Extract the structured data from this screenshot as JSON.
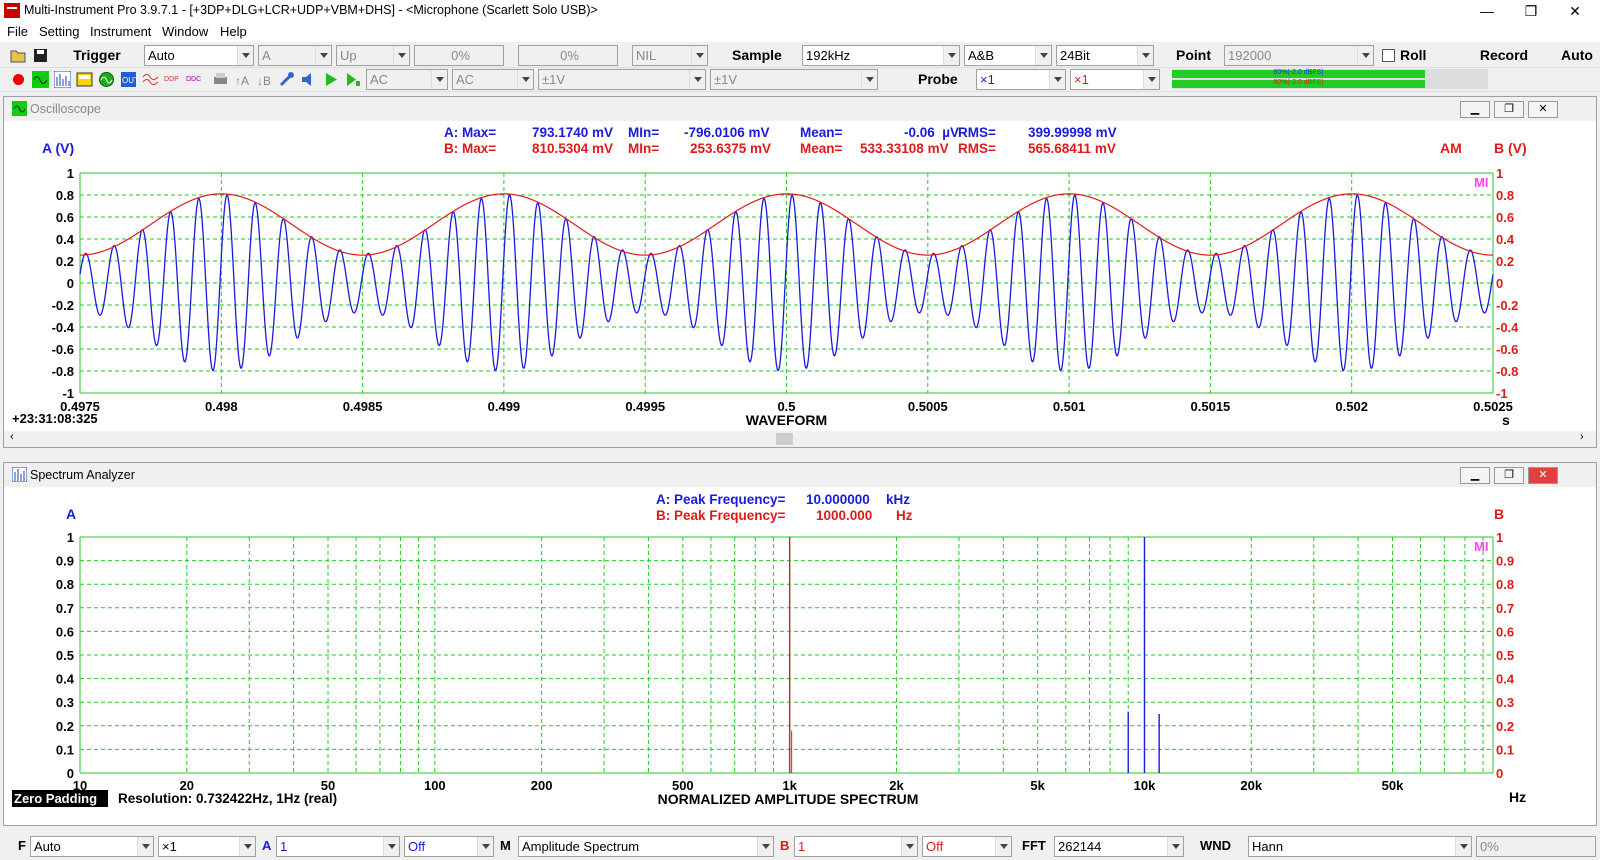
{
  "app": {
    "title": "Multi-Instrument Pro 3.9.7.1   -  [+3DP+DLG+LCR+UDP+VBM+DHS]   -   <Microphone (Scarlett Solo USB)>",
    "window_buttons": [
      "—",
      "❐",
      "✕"
    ]
  },
  "menu": [
    "File",
    "Setting",
    "Instrument",
    "Window",
    "Help"
  ],
  "toolbar1": {
    "trigger_label": "Trigger",
    "trigger_mode": "Auto",
    "trigger_channel": "A",
    "trigger_edge": "Up",
    "trigger_level": "0%",
    "trigger_pre": "0%",
    "trigger_nil": "NIL",
    "sample_label": "Sample",
    "sample_rate": "192kHz",
    "channels": "A&B",
    "bit_depth": "24Bit",
    "point_label": "Point",
    "point_value": "192000",
    "roll_label": "Roll",
    "record_label": "Record",
    "auto_label": "Auto"
  },
  "toolbar2": {
    "coupling_a": "AC",
    "coupling_b": "AC",
    "range_a": "±1V",
    "range_b": "±1V",
    "probe_label": "Probe",
    "probe_a": "×1",
    "probe_b": "×1",
    "meter_a": "80%(-2.0 dBFS)",
    "meter_b": "80%(-2.0 dBFS)"
  },
  "oscilloscope": {
    "title": "Oscilloscope",
    "a_stats": {
      "max_label": "A: Max=",
      "max": "793.1740 mV",
      "min_label": "MIn=",
      "min": "-796.0106 mV",
      "mean_label": "Mean=",
      "mean": "-0.06  µV",
      "rms_label": "RMS=",
      "rms": "399.99998 mV"
    },
    "b_stats": {
      "max_label": "B: Max=",
      "max": "810.5304 mV",
      "min_label": "MIn=",
      "min": "253.6375 mV",
      "mean_label": "Mean=",
      "mean": "533.33108 mV",
      "rms_label": "RMS=",
      "rms": "565.68411 mV"
    },
    "a_axis_label": "A (V)",
    "b_axis_label": "B (V)",
    "am_label": "AM",
    "mi_logo": "MI",
    "timestamp": "+23:31:08:325",
    "xlabel": "WAVEFORM",
    "xunit": "s"
  },
  "spectrum": {
    "title": "Spectrum Analyzer",
    "a_peak_label": "A: Peak Frequency=",
    "a_peak_value": "10.000000",
    "a_peak_unit": "kHz",
    "b_peak_label": "B: Peak Frequency=",
    "b_peak_value": "1000.000",
    "b_peak_unit": "Hz",
    "a_axis_label": "A",
    "b_axis_label": "B",
    "mi_logo": "MI",
    "zero_padding": "Zero Padding",
    "resolution": "Resolution: 0.732422Hz, 1Hz (real)",
    "xlabel": "NORMALIZED AMPLITUDE SPECTRUM",
    "xunit": "Hz"
  },
  "bottombar": {
    "f_label": "F",
    "f_mode": "Auto",
    "f_mult": "×1",
    "a_label": "A",
    "a_val": "1",
    "a_off": "Off",
    "m_label": "M",
    "m_mode": "Amplitude Spectrum",
    "b_label": "B",
    "b_val": "1",
    "b_off": "Off",
    "fft_label": "FFT",
    "fft_size": "262144",
    "wnd_label": "WND",
    "wnd_type": "Hann",
    "overlap": "0%"
  },
  "colors": {
    "channel_a": "#1a1ae0",
    "channel_b": "#e01a1a",
    "grid": "#22cc22",
    "mi_logo": "#ff44ff"
  },
  "chart_data": [
    {
      "type": "line",
      "title": "WAVEFORM",
      "xlabel": "",
      "xunit": "s",
      "x_ticks": [
        "0.4975",
        "0.498",
        "0.4985",
        "0.499",
        "0.4995",
        "0.5",
        "0.5005",
        "0.501",
        "0.5015",
        "0.502",
        "0.5025"
      ],
      "xlim": [
        0.4975,
        0.5025
      ],
      "y_ticks_a": [
        "1",
        "0.8",
        "0.6",
        "0.4",
        "0.2",
        "0",
        "-0.2",
        "-0.4",
        "-0.6",
        "-0.8",
        "-1"
      ],
      "y_ticks_b": [
        "1",
        "0.8",
        "0.6",
        "0.4",
        "0.2",
        "0",
        "-0.2",
        "-0.4",
        "-0.6",
        "-0.8",
        "-1"
      ],
      "ylim": [
        -1,
        1
      ],
      "grid": true,
      "series": [
        {
          "name": "A",
          "carrier_hz": 10000,
          "modulation_hz": 1000,
          "envelope_min": 0.267,
          "envelope_max": 0.8
        },
        {
          "name": "B",
          "signal": "envelope",
          "frequency_hz": 1000,
          "min": 0.2536,
          "max": 0.8105
        }
      ]
    },
    {
      "type": "line",
      "title": "NORMALIZED AMPLITUDE SPECTRUM",
      "xunit": "Hz",
      "x_scale": "log",
      "x_ticks": [
        "10",
        "20",
        "50",
        "100",
        "200",
        "500",
        "1k",
        "2k",
        "5k",
        "10k",
        "20k",
        "50k"
      ],
      "x_tick_values": [
        10,
        20,
        50,
        100,
        200,
        500,
        1000,
        2000,
        5000,
        10000,
        20000,
        50000
      ],
      "xlim": [
        10,
        96000
      ],
      "y_ticks_a": [
        "1",
        "0.9",
        "0.8",
        "0.7",
        "0.6",
        "0.5",
        "0.4",
        "0.3",
        "0.2",
        "0.1",
        "0"
      ],
      "y_ticks_b": [
        "1",
        "0.9",
        "0.8",
        "0.7",
        "0.6",
        "0.5",
        "0.4",
        "0.3",
        "0.2",
        "0.1",
        "0"
      ],
      "ylim": [
        0,
        1
      ],
      "grid": true,
      "series": [
        {
          "name": "A",
          "peaks": [
            {
              "x": 9000,
              "y": 0.26
            },
            {
              "x": 10000,
              "y": 1.0
            },
            {
              "x": 11000,
              "y": 0.25
            }
          ]
        },
        {
          "name": "B",
          "peaks": [
            {
              "x": 1000,
              "y": 1.0
            }
          ]
        }
      ]
    }
  ]
}
